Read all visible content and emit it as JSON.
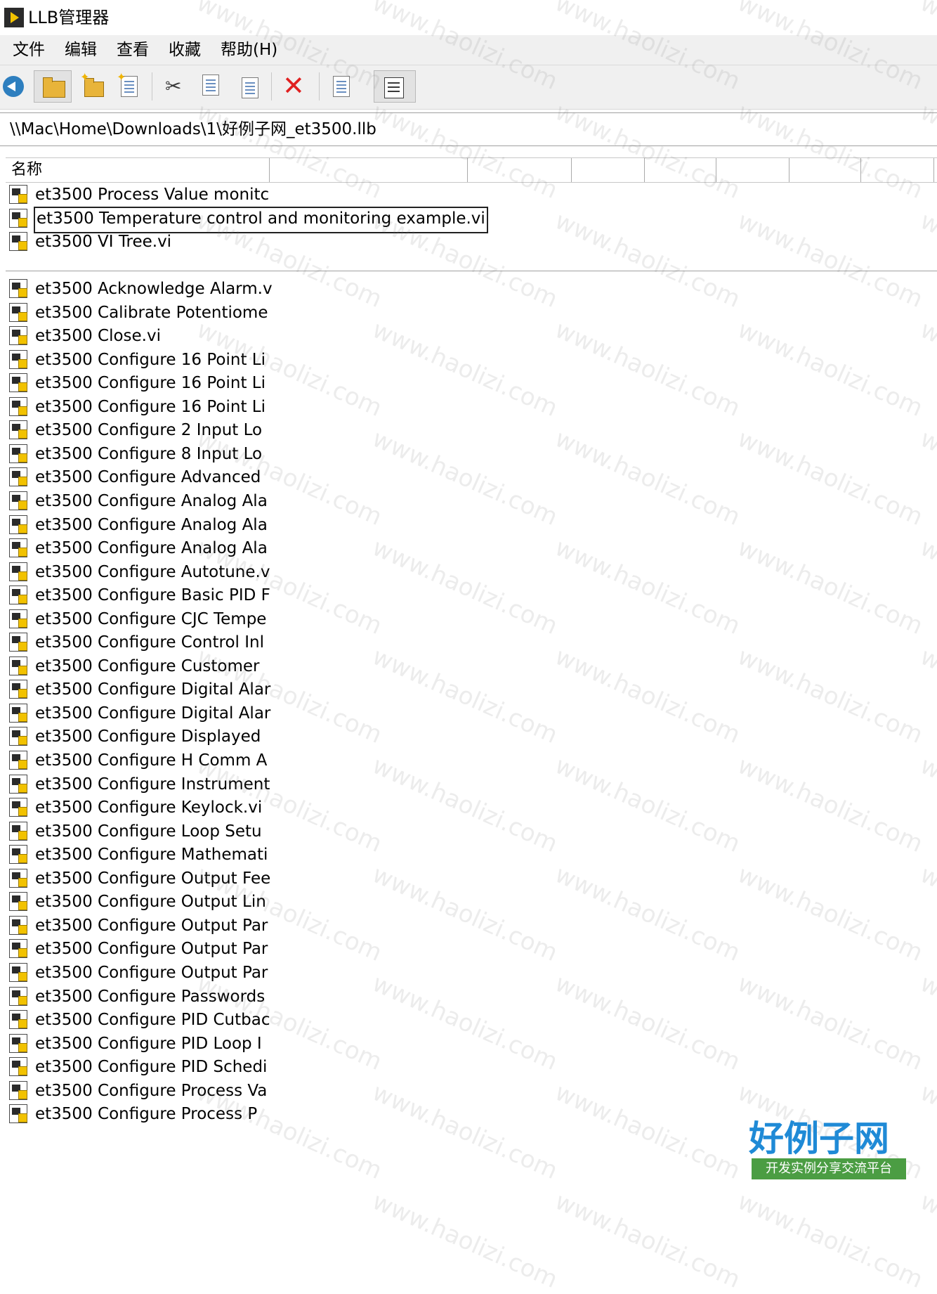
{
  "window": {
    "title": "LLB管理器"
  },
  "menu": {
    "items": [
      "文件",
      "编辑",
      "查看",
      "收藏",
      "帮助(H)"
    ]
  },
  "toolbar": {
    "buttons": [
      {
        "icon": "back-arrow-icon"
      },
      {
        "icon": "open-folder-icon"
      },
      {
        "icon": "new-folder-icon"
      },
      {
        "icon": "new-vi-icon"
      },
      {
        "icon": "cut-icon"
      },
      {
        "icon": "copy-icon"
      },
      {
        "icon": "paste-icon"
      },
      {
        "icon": "delete-icon"
      },
      {
        "icon": "move-icon"
      },
      {
        "icon": "list-view-icon"
      }
    ]
  },
  "path": "\\\\Mac\\Home\\Downloads\\1\\好例子网_et3500.llb",
  "list": {
    "column_name": "名称",
    "top_level": [
      "et3500 Process Value monitc",
      "et3500 Temperature control and monitoring example.vi",
      "et3500 VI Tree.vi"
    ],
    "selected_index": 1,
    "items": [
      "et3500 Acknowledge Alarm.v",
      "et3500 Calibrate Potentiome",
      "et3500 Close.vi",
      "et3500 Configure 16 Point Li",
      "et3500 Configure 16 Point Li",
      "et3500 Configure 16 Point Li",
      "et3500 Configure 2 Input Lo",
      "et3500 Configure 8 Input Lo",
      "et3500 Configure Advanced",
      "et3500 Configure Analog Ala",
      "et3500 Configure Analog Ala",
      "et3500 Configure Analog Ala",
      "et3500 Configure Autotune.v",
      "et3500 Configure Basic PID F",
      "et3500 Configure CJC Tempe",
      "et3500 Configure Control Inl",
      "et3500 Configure Customer",
      "et3500 Configure Digital Alar",
      "et3500 Configure Digital Alar",
      "et3500 Configure Displayed",
      "et3500 Configure H Comm A",
      "et3500 Configure Instrument",
      "et3500 Configure Keylock.vi",
      "et3500 Configure Loop Setu",
      "et3500 Configure Mathemati",
      "et3500 Configure Output Fee",
      "et3500 Configure Output Lin",
      "et3500 Configure Output Par",
      "et3500 Configure Output Par",
      "et3500 Configure Output Par",
      "et3500 Configure Passwords",
      "et3500 Configure PID Cutbac",
      "et3500 Configure PID Loop I",
      "et3500 Configure PID Schedi",
      "et3500 Configure Process Va",
      "et3500 Configure Process P"
    ]
  },
  "watermark": {
    "text": "www.haolizi.com"
  },
  "logo": {
    "main": "好例子网",
    "sub": "开发实例分享交流平台"
  }
}
